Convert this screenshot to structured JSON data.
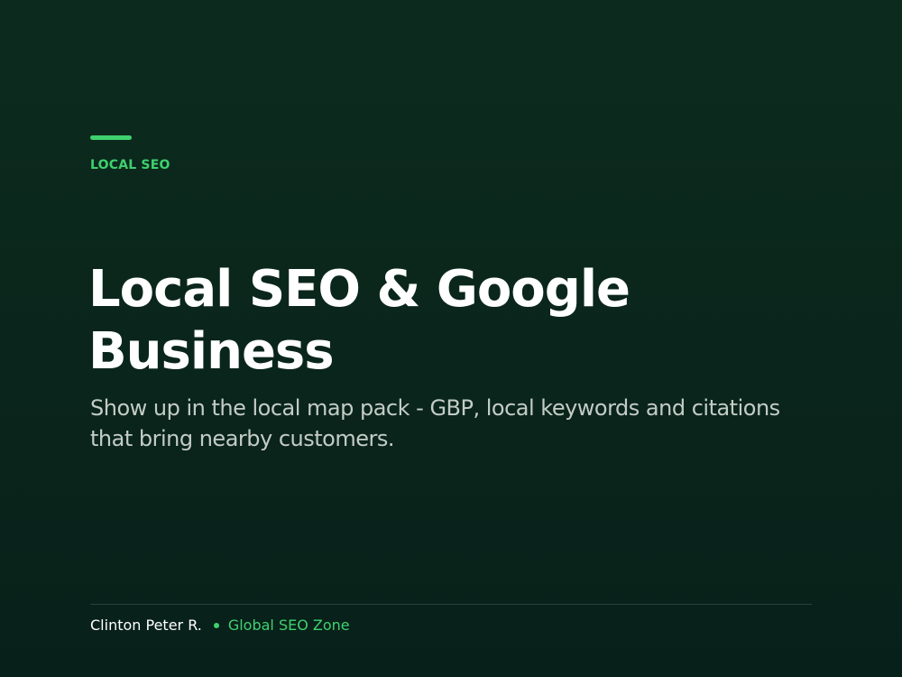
{
  "slide": {
    "eyebrow": "LOCAL SEO",
    "title": "Local SEO & Google Business",
    "subtitle": "Show up in the local map pack - GBP, local keywords and citations that bring nearby customers."
  },
  "footer": {
    "author": "Clinton Peter R.",
    "brand": "Global SEO Zone"
  },
  "colors": {
    "background": "#0b271c",
    "accent": "#3fd16f",
    "title": "#ffffff",
    "subtitle": "#c3ccc7"
  }
}
